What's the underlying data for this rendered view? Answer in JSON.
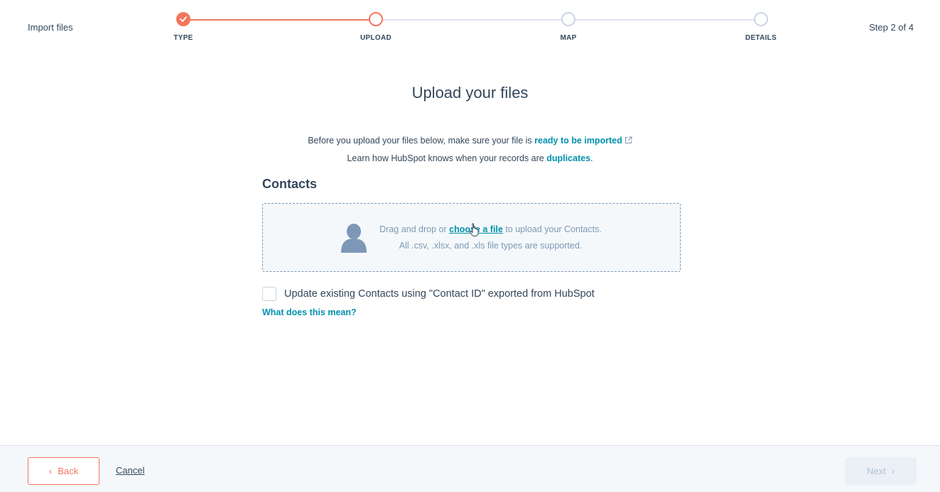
{
  "header": {
    "app_title": "Import files",
    "step_count": "Step 2 of 4"
  },
  "stepper": {
    "steps": [
      {
        "label": "TYPE",
        "state": "complete"
      },
      {
        "label": "UPLOAD",
        "state": "current"
      },
      {
        "label": "MAP",
        "state": "pending"
      },
      {
        "label": "DETAILS",
        "state": "pending"
      }
    ]
  },
  "main": {
    "title": "Upload your files",
    "intro_line1_prefix": "Before you upload your files below, make sure your file is ",
    "intro_line1_link": "ready to be imported",
    "intro_line2_prefix": "Learn how HubSpot knows when your records are ",
    "intro_line2_link": "duplicates",
    "intro_line2_suffix": ".",
    "section_title": "Contacts",
    "dropzone": {
      "text_prefix": "Drag and drop or ",
      "link": "choose a file",
      "text_suffix": " to upload your Contacts.",
      "supported": "All .csv, .xlsx, and .xls file types are supported."
    },
    "checkbox_label": "Update existing Contacts using \"Contact ID\" exported from HubSpot",
    "help_link": "What does this mean?"
  },
  "footer": {
    "back_label": "Back",
    "cancel_label": "Cancel",
    "next_label": "Next"
  },
  "colors": {
    "accent": "#f2765c",
    "link": "#0091ae",
    "text": "#33475b",
    "border": "#cbd6e2"
  },
  "icons": {
    "step_complete": "check-icon",
    "external_link": "external-link-icon",
    "dropzone": "person-icon",
    "back": "chevron-left-icon",
    "next": "chevron-right-icon",
    "cursor": "hand-pointer-icon"
  }
}
